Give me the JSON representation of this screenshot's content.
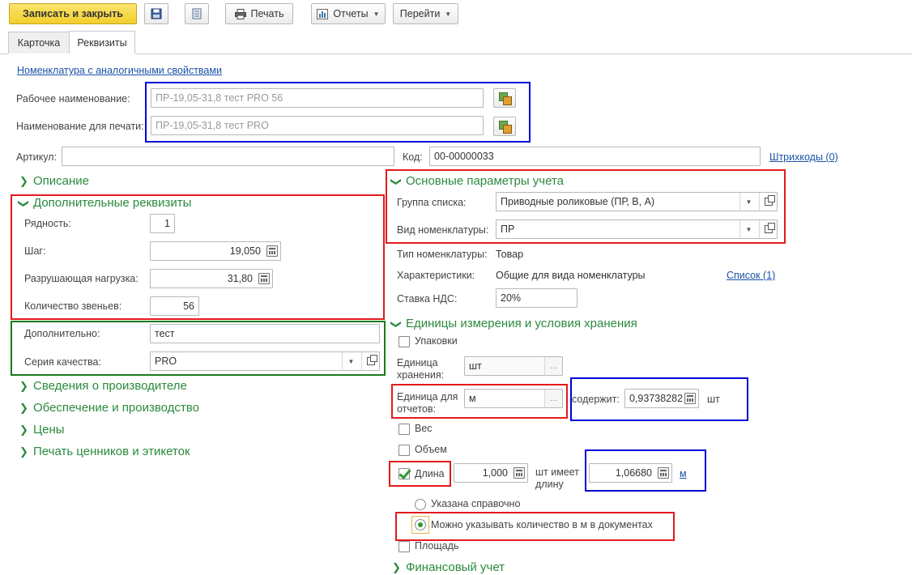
{
  "toolbar": {
    "save_close": "Записать и закрыть",
    "print": "Печать",
    "reports": "Отчеты",
    "goto": "Перейти"
  },
  "tabs": [
    {
      "label": "Карточка",
      "active": false
    },
    {
      "label": "Реквизиты",
      "active": true
    }
  ],
  "header": {
    "similar_link": "Номенклатура с аналогичными свойствами",
    "work_name_label": "Рабочее наименование:",
    "work_name_value": "ПР-19,05-31,8 тест PRO 56",
    "print_name_label": "Наименование для печати:",
    "print_name_value": "ПР-19,05-31,8 тест PRO",
    "article_label": "Артикул:",
    "article_value": "",
    "code_label": "Код:",
    "code_value": "00-00000033",
    "barcodes_link": "Штрихкоды (0)"
  },
  "left": {
    "description": "Описание",
    "extra_props": {
      "title": "Дополнительные реквизиты",
      "rows_label": "Рядность:",
      "rows_value": "1",
      "pitch_label": "Шаг:",
      "pitch_value": "19,050",
      "load_label": "Разрушающая нагрузка:",
      "load_value": "31,80",
      "links_label": "Количество звеньев:",
      "links_value": "56"
    },
    "additional_label": "Дополнительно:",
    "additional_value": "тест",
    "quality_label": "Серия качества:",
    "quality_value": "PRO",
    "sections": [
      "Сведения о производителе",
      "Обеспечение и производство",
      "Цены",
      "Печать ценников и этикеток"
    ]
  },
  "right": {
    "main_params": {
      "title": "Основные параметры учета",
      "group_label": "Группа списка:",
      "group_value": "Приводные роликовые (ПР, В, А)",
      "kind_label": "Вид номенклатуры:",
      "kind_value": "ПР"
    },
    "type_label": "Тип номенклатуры:",
    "type_value": "Товар",
    "chars_label": "Характеристики:",
    "chars_value": "Общие для вида номенклатуры",
    "chars_link": "Список (1)",
    "vat_label": "Ставка НДС:",
    "vat_value": "20%",
    "units": {
      "title": "Единицы измерения и условия хранения",
      "packages": "Упаковки",
      "storage_unit_label_1": "Единица",
      "storage_unit_label_2": "хранения:",
      "storage_unit_value": "шт",
      "report_unit_label_1": "Единица для",
      "report_unit_label_2": "отчетов:",
      "report_unit_value": "м",
      "contains_label": "содержит:",
      "contains_value": "0,93738282",
      "contains_unit": "шт",
      "weight": "Вес",
      "volume": "Объем",
      "length": "Длина",
      "length_value": "1,000",
      "has_length_1": "шт имеет",
      "has_length_2": "длину",
      "length_per": "1,06680",
      "length_unit": "м",
      "radio_reference": "Указана справочно",
      "radio_docs": "Можно указывать количество в м в документах",
      "area": "Площадь"
    },
    "finance": "Финансовый учет"
  },
  "colors": {
    "accent_green": "#2b8a3e",
    "highlight_red": "#e31a1c",
    "highlight_blue": "#0000d8",
    "highlight_green": "#1a7a1a",
    "primary_button": "#f2cf2d",
    "link": "#1a52a8"
  }
}
